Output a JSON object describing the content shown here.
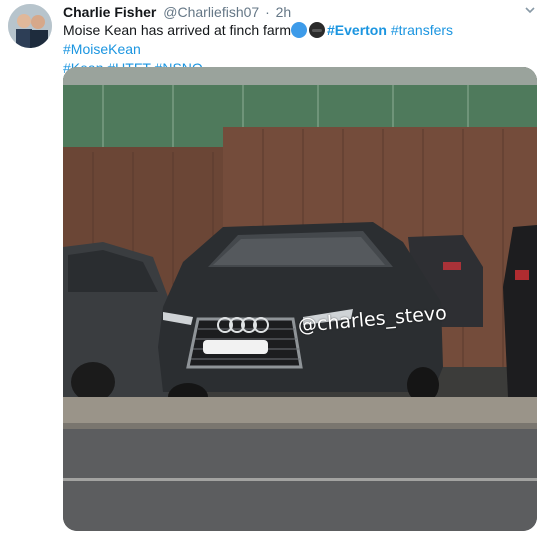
{
  "tweet": {
    "author_name": "Charlie Fisher",
    "author_handle": "@Charliefish07",
    "separator": "·",
    "time": "2h",
    "text_prefix": "Moise Kean has arrived at finch farm",
    "hashtag_everton": "#Everton",
    "hashtags_line1": "#transfers #MoiseKean",
    "hashtags_line2": "#Kean #UTFT #NSNO",
    "icons": {
      "avatar": "user-avatar",
      "menu": "chevron-down-icon",
      "emoji1": "blue-circle-emoji",
      "emoji2": "sunglasses-face-emoji"
    },
    "colors": {
      "link": "#1b95e0",
      "name": "#14171a",
      "meta": "#657786"
    }
  },
  "photo": {
    "watermark": "@charles_stevo"
  }
}
